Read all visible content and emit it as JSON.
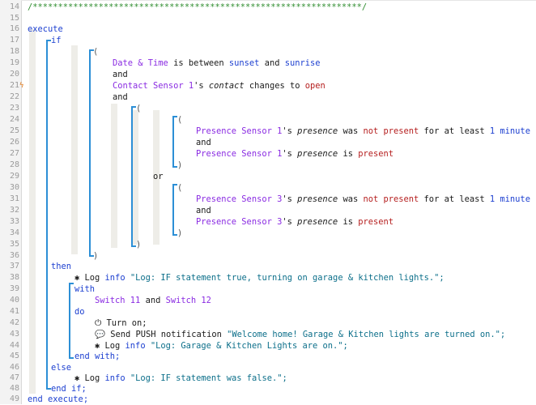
{
  "line_numbers": [
    "14",
    "15",
    "16",
    "17",
    "18",
    "19",
    "20",
    "21",
    "22",
    "23",
    "24",
    "25",
    "26",
    "27",
    "28",
    "29",
    "30",
    "31",
    "32",
    "33",
    "34",
    "35",
    "36",
    "37",
    "38",
    "39",
    "40",
    "41",
    "42",
    "43",
    "44",
    "45",
    "46",
    "47",
    "48",
    "49"
  ],
  "header_comment": "/*****************************************************************/",
  "kw": {
    "execute": "execute",
    "if": "if",
    "and": "and",
    "or": "or",
    "open_paren": "(",
    "close_paren": ")",
    "then": "then",
    "with": "with",
    "do": "do",
    "end_with": "end with;",
    "else": "else",
    "end_if": "end if;",
    "end_execute": "end execute;"
  },
  "condition1": {
    "subject": "Date & Time",
    "text1": " is between ",
    "a": "sunset",
    "text2": " and ",
    "b": "sunrise"
  },
  "condition2": {
    "subject": "Contact Sensor 1",
    "possessive": "'s ",
    "attr": "contact",
    "text": " changes to ",
    "value": "open"
  },
  "presence1a": {
    "subject": "Presence Sensor 1",
    "possessive": "'s ",
    "attr": "presence",
    "text1": " was ",
    "value": "not present",
    "text2": " for at least ",
    "num": "1",
    "unit": " minute"
  },
  "presence1b": {
    "subject": "Presence Sensor 1",
    "possessive": "'s ",
    "attr": "presence",
    "text": " is ",
    "value": "present"
  },
  "presence3a": {
    "subject": "Presence Sensor 3",
    "possessive": "'s ",
    "attr": "presence",
    "text1": " was ",
    "value": "not present",
    "text2": " for at least ",
    "num": "1",
    "unit": " minute"
  },
  "presence3b": {
    "subject": "Presence Sensor 3",
    "possessive": "'s ",
    "attr": "presence",
    "text": " is ",
    "value": "present"
  },
  "log_then": {
    "icon": "bug-icon",
    "label": " Log ",
    "level": "info",
    "message": " \"Log: IF statement true, turning on garage & kitchen lights.\";"
  },
  "with_devices": {
    "a": "Switch 11",
    "and": " and ",
    "b": "Switch 12"
  },
  "turn_on": {
    "icon": "power-icon",
    "label": " Turn on;"
  },
  "push": {
    "icon": "chat-bubble-icon",
    "label": " Send PUSH notification ",
    "message": "\"Welcome home! Garage & Kitchen lights are turned on.\";"
  },
  "log_do": {
    "icon": "bug-icon",
    "label": " Log ",
    "level": "info",
    "message": " \"Log: Garage & Kitchen Lights are on.\";"
  },
  "log_else": {
    "icon": "bug-icon",
    "label": " Log ",
    "level": "info",
    "message": " \"Log: IF statement was false.\";"
  },
  "colors": {
    "keyword": "#1c3fd0",
    "device": "#8a2be2",
    "value": "#b51e1e",
    "bracket": "#2c8fd6",
    "comment": "#2f8d2f"
  }
}
